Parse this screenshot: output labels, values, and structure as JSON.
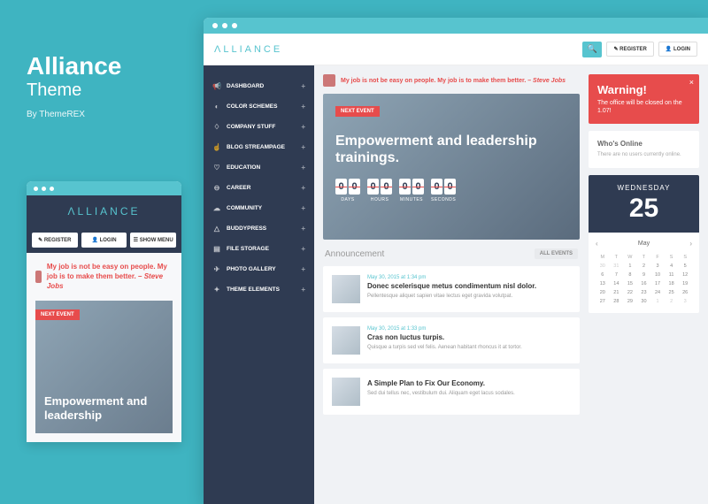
{
  "promo": {
    "title": "Alliance",
    "subtitle": "Theme",
    "byline": "By ThemeREX"
  },
  "logo": "ΛLLIANCE",
  "mobile_buttons": {
    "register": "✎ REGISTER",
    "login": "👤 LOGIN",
    "menu": "☰ SHOW MENU"
  },
  "desktop_buttons": {
    "register": "✎ REGISTER",
    "login": "👤 LOGIN"
  },
  "quote": {
    "text": "My job is not be easy on people. My job is to make them better.",
    "attribution": "– Steve Jobs"
  },
  "hero": {
    "tag": "NEXT EVENT",
    "title_desktop": "Empowerment and leadership trainings.",
    "title_mobile": "Empowerment and leadership",
    "countdown": {
      "days": "00",
      "hours": "00",
      "minutes": "00",
      "seconds": "00",
      "l_days": "DAYS",
      "l_hours": "HOURS",
      "l_minutes": "MINUTES",
      "l_seconds": "SECONDS"
    }
  },
  "sidebar": [
    {
      "icon": "📢",
      "label": "DASHBOARD"
    },
    {
      "icon": "◐",
      "label": "COLOR SCHEMES"
    },
    {
      "icon": "♢",
      "label": "COMPANY STUFF"
    },
    {
      "icon": "☝",
      "label": "BLOG STREAMPAGE"
    },
    {
      "icon": "♡",
      "label": "EDUCATION"
    },
    {
      "icon": "⊖",
      "label": "CAREER"
    },
    {
      "icon": "☁",
      "label": "COMMUNITY"
    },
    {
      "icon": "△",
      "label": "BUDDYPRESS"
    },
    {
      "icon": "▤",
      "label": "FILE STORAGE"
    },
    {
      "icon": "✈",
      "label": "PHOTO GALLERY"
    },
    {
      "icon": "✦",
      "label": "THEME ELEMENTS"
    }
  ],
  "announcement": {
    "title": "Announcement",
    "all_btn": "ALL EVENTS",
    "items": [
      {
        "date": "May 30, 2015 at 1:34 pm",
        "title": "Donec scelerisque metus condimentum nisl dolor.",
        "desc": "Pellentesque aliquet sapien vitae lectus eget gravida volutpat."
      },
      {
        "date": "May 30, 2015 at 1:33 pm",
        "title": "Cras non luctus turpis.",
        "desc": "Quisque a turpis sed vel felis. Aenean habitant rhoncus it at tortor."
      },
      {
        "date": "",
        "title": "A Simple Plan to Fix Our Economy.",
        "desc": "Sed dui tellus nec, vestibulum dui. Aliquam eget lacus sodales."
      }
    ]
  },
  "warning": {
    "title": "Warning!",
    "desc": "The office will be closed on the 1.07!"
  },
  "whos_online": {
    "title": "Who's Online",
    "desc": "There are no users currently online."
  },
  "calendar": {
    "dayname": "WEDNESDAY",
    "daynum": "25",
    "month": "May",
    "dow": [
      "M",
      "T",
      "W",
      "T",
      "F",
      "S",
      "S"
    ],
    "weeks": [
      [
        "30",
        "31",
        "1",
        "2",
        "3",
        "4",
        "5"
      ],
      [
        "6",
        "7",
        "8",
        "9",
        "10",
        "11",
        "12"
      ],
      [
        "13",
        "14",
        "15",
        "16",
        "17",
        "18",
        "19"
      ],
      [
        "20",
        "21",
        "22",
        "23",
        "24",
        "25",
        "26"
      ],
      [
        "27",
        "28",
        "29",
        "30",
        "1",
        "2",
        "3"
      ]
    ]
  }
}
